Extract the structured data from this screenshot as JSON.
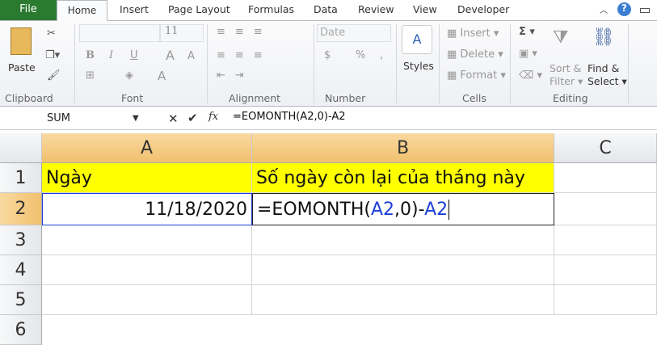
{
  "tabs": {
    "file": "File",
    "home": "Home",
    "insert": "Insert",
    "page_layout": "Page Layout",
    "formulas": "Formulas",
    "data": "Data",
    "review": "Review",
    "view": "View",
    "developer": "Developer"
  },
  "ribbon": {
    "clipboard": {
      "paste": "Paste",
      "label": "Clipboard"
    },
    "font": {
      "size": "11",
      "label": "Font",
      "bold": "B",
      "italic": "I",
      "underline": "U"
    },
    "alignment": {
      "label": "Alignment"
    },
    "number": {
      "format": "Date",
      "label": "Number",
      "currency": "$",
      "percent": "%",
      "comma": ","
    },
    "styles": {
      "label": "Styles"
    },
    "cells": {
      "insert": "Insert",
      "delete": "Delete",
      "format": "Format",
      "label": "Cells"
    },
    "editing": {
      "sort1": "Sort &",
      "sort2": "Filter",
      "find1": "Find &",
      "find2": "Select",
      "label": "Editing"
    }
  },
  "formula_bar": {
    "name_box": "SUM",
    "fx": "fx",
    "formula": "=EOMONTH(A2,0)-A2"
  },
  "columns": [
    "A",
    "B",
    "C"
  ],
  "rows": [
    "1",
    "2",
    "3",
    "4",
    "5",
    "6"
  ],
  "cells": {
    "A1": "Ngày",
    "B1": "Số ngày còn lại của tháng này",
    "A2": "11/18/2020",
    "B2_parts": [
      "=EOMONTH(",
      "A2",
      ",0)-",
      "A2"
    ]
  },
  "colors": {
    "highlight": "#ffff00",
    "ref": "#1d3fd6",
    "file_tab": "#2a7a2f"
  }
}
